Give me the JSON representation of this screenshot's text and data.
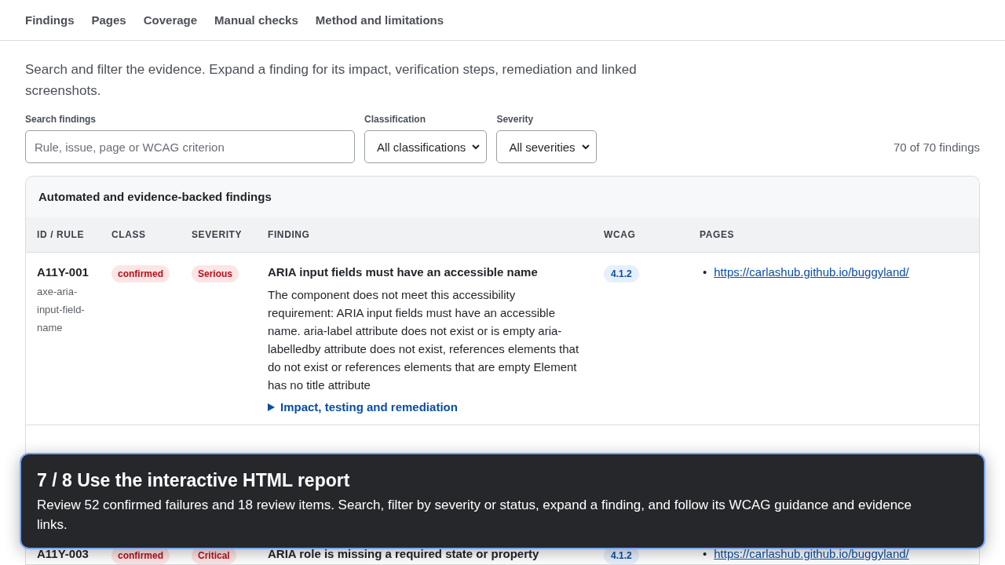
{
  "nav": {
    "items": [
      "Findings",
      "Pages",
      "Coverage",
      "Manual checks",
      "Method and limitations"
    ]
  },
  "intro": "Search and filter the evidence. Expand a finding for its impact, verification steps, remediation and linked screenshots.",
  "filters": {
    "search": {
      "label": "Search findings",
      "placeholder": "Rule, issue, page or WCAG criterion"
    },
    "classification": {
      "label": "Classification",
      "value": "All classifications"
    },
    "severity": {
      "label": "Severity",
      "value": "All severities"
    },
    "count": "70 of 70 findings"
  },
  "findings_table": {
    "title": "Automated and evidence-backed findings",
    "columns": [
      "ID / RULE",
      "CLASS",
      "SEVERITY",
      "FINDING",
      "WCAG",
      "PAGES"
    ],
    "rows": [
      {
        "kind": "finding",
        "id": "A11Y-001",
        "rule": "axe-aria-input-field-name",
        "class": "confirmed",
        "severity": "Serious",
        "title": "ARIA input fields must have an accessible name",
        "description": "The component does not meet this accessibility requirement: ARIA input fields must have an accessible name. aria-label attribute does not exist or is empty aria-labelledby attribute does not exist, references elements that do not exist or references elements that are empty Element has no title attribute",
        "details": {
          "label": "Impact, testing and remediation",
          "expanded": false
        },
        "wcag": "4.1.2",
        "pages": [
          {
            "marker": "•",
            "url": "https://carlashub.github.io/buggyland/"
          }
        ]
      },
      {
        "kind": "covered"
      },
      {
        "kind": "finding",
        "id": "A11Y-003",
        "class": "confirmed",
        "severity": "Critical",
        "title": "ARIA role is missing a required state or property",
        "wcag": "4.1.2",
        "pages": [
          {
            "marker": "•",
            "url": "https://carlashub.github.io/buggyland/"
          }
        ]
      }
    ]
  },
  "popover": {
    "title": "7 / 8 Use the interactive HTML report",
    "body": "Review 52 confirmed failures and 18 review items. Search, filter by severity or status, expand a finding, and follow its WCAG guidance and evidence links."
  }
}
